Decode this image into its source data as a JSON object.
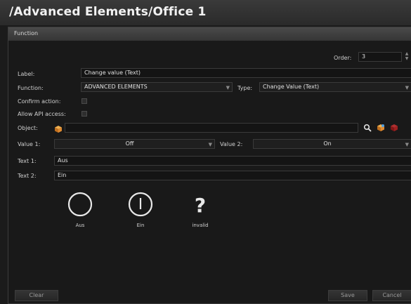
{
  "window": {
    "title": "/Advanced Elements/Office 1"
  },
  "panel": {
    "header": "Function"
  },
  "form": {
    "order_label": "Order:",
    "order_value": "3",
    "label_label": "Label:",
    "label_value": "Change value (Text)",
    "function_label": "Function:",
    "function_value": "ADVANCED ELEMENTS",
    "type_label": "Type:",
    "type_value": "Change Value (Text)",
    "confirm_label": "Confirm action:",
    "confirm_checked": false,
    "api_label": "Allow API access:",
    "api_checked": false,
    "object_label": "Object:",
    "object_value": "",
    "value1_label": "Value 1:",
    "value1_value": "Off",
    "value2_label": "Value 2:",
    "value2_value": "On",
    "text1_label": "Text 1:",
    "text1_value": "Aus",
    "text2_label": "Text 2:",
    "text2_value": "Ein"
  },
  "preview": {
    "states": [
      {
        "icon": "circle-off-icon",
        "caption": "Aus"
      },
      {
        "icon": "circle-on-icon",
        "caption": "Ein"
      },
      {
        "icon": "question-mark-icon",
        "caption": "invalid"
      }
    ]
  },
  "buttons": {
    "clear": "Clear",
    "save": "Save",
    "cancel": "Cancel"
  },
  "colors": {
    "background": "#1b1b1b",
    "panel_header": "#404040",
    "field": "#141414",
    "text": "#d0d0d0"
  }
}
